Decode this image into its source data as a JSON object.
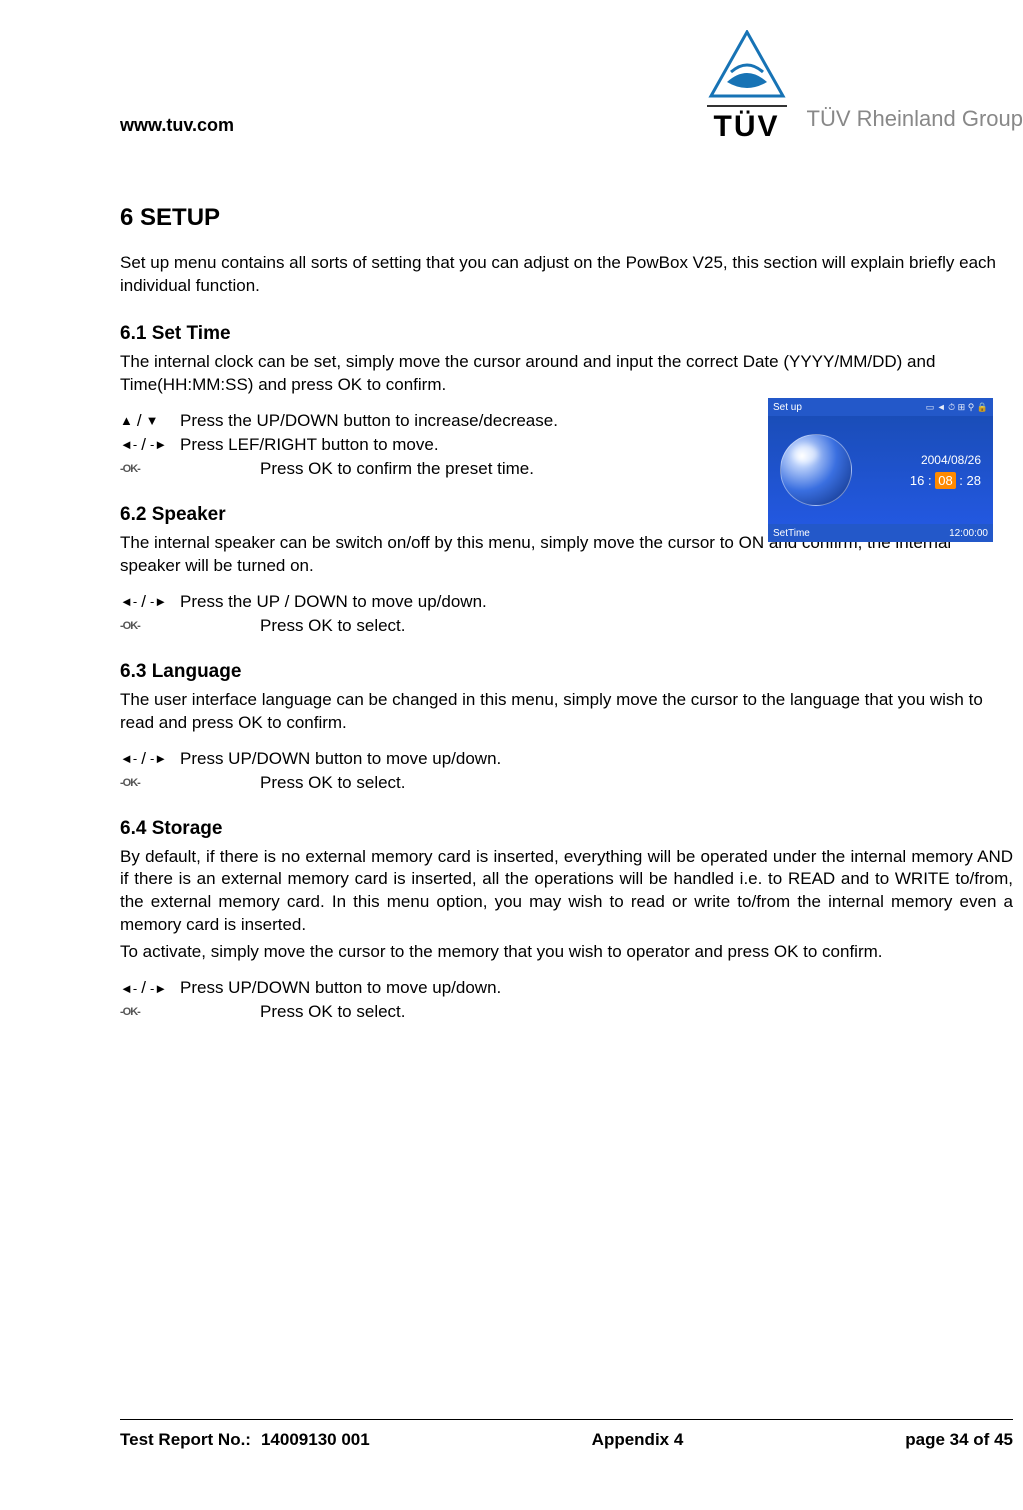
{
  "header": {
    "url": "www.tuv.com",
    "logo_text": "TÜV",
    "group_text": "TÜV Rheinland Group"
  },
  "h1": "6 SETUP",
  "intro": "Set up menu contains all sorts of setting that you can adjust on the PowBox V25, this section will explain briefly each individual function.",
  "s61": {
    "title": "6.1 Set Time",
    "body": "The internal clock can be set, simply move the cursor around and input the correct Date (YYYY/MM/DD) and Time(HH:MM:SS) and press OK to confirm.",
    "r1": "Press the UP/DOWN button to increase/decrease.",
    "r2": "Press LEF/RIGHT button to move.",
    "r3": "Press OK to confirm the preset time."
  },
  "s62": {
    "title": "6.2 Speaker",
    "body": "The internal speaker can be switch on/off by this menu, simply move the cursor to ON and confirm, the internal speaker will be turned on.",
    "r1": "Press the UP / DOWN to move up/down.",
    "r2": "Press OK to select."
  },
  "s63": {
    "title": "6.3 Language",
    "body": "The user interface language can be changed in this menu, simply move the cursor to the language that you wish to read and press OK to confirm.",
    "r1": "Press UP/DOWN button to move up/down.",
    "r2": "Press OK to select."
  },
  "s64": {
    "title": "6.4 Storage",
    "body1": "By default, if there is no external memory card is inserted, everything will be operated under the internal memory AND if there is an external memory card is inserted, all the operations will be handled i.e. to READ and to WRITE to/from, the external memory card. In this menu option, you may wish to read or write to/from the internal memory even a memory card is inserted.",
    "body2": "To activate, simply move the cursor to the memory that you wish to operator and press OK to confirm.",
    "r1": "Press UP/DOWN button to move up/down.",
    "r2": "Press OK to select."
  },
  "screenshot": {
    "top_label": "Set up",
    "date": "2004/08/26",
    "hour": "16",
    "minute": "08",
    "second": "28",
    "bottom_label": "SetTime",
    "clock": "12:00:00"
  },
  "footer": {
    "label": "Test Report No.:",
    "number": "14009130 001",
    "center": "Appendix 4",
    "page": "page 34 of 45"
  }
}
